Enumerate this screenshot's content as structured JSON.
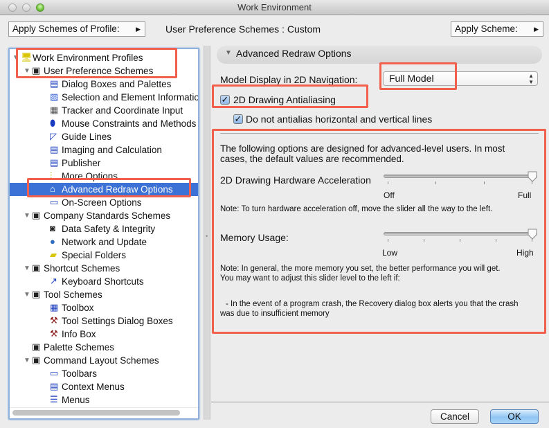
{
  "window": {
    "title": "Work Environment"
  },
  "toolbar": {
    "apply_profile_label": "Apply Schemes of Profile:",
    "current_scheme_label": "User Preference Schemes : Custom",
    "apply_scheme_label": "Apply Scheme:"
  },
  "tree": {
    "items": [
      {
        "label": "Work Environment Profiles",
        "level": 0,
        "expanded": true,
        "icon": "profiles-icon"
      },
      {
        "label": "User Preference Schemes",
        "level": 1,
        "expanded": true,
        "icon": "user-prefs-icon"
      },
      {
        "label": "Dialog Boxes and Palettes",
        "level": 2,
        "icon": "dialog-boxes-icon"
      },
      {
        "label": "Selection and Element Information",
        "level": 2,
        "icon": "selection-icon"
      },
      {
        "label": "Tracker and Coordinate Input",
        "level": 2,
        "icon": "tracker-icon"
      },
      {
        "label": "Mouse Constraints and Methods",
        "level": 2,
        "icon": "mouse-icon"
      },
      {
        "label": "Guide Lines",
        "level": 2,
        "icon": "guide-lines-icon"
      },
      {
        "label": "Imaging and Calculation",
        "level": 2,
        "icon": "imaging-icon"
      },
      {
        "label": "Publisher",
        "level": 2,
        "icon": "publisher-icon"
      },
      {
        "label": "More Options",
        "level": 2,
        "icon": "more-options-icon"
      },
      {
        "label": "Advanced Redraw Options",
        "level": 2,
        "icon": "redraw-icon",
        "selected": true
      },
      {
        "label": "On-Screen Options",
        "level": 2,
        "icon": "onscreen-icon"
      },
      {
        "label": "Company Standards Schemes",
        "level": 1,
        "expanded": true,
        "icon": "company-standards-icon"
      },
      {
        "label": "Data Safety & Integrity",
        "level": 2,
        "icon": "data-safety-icon"
      },
      {
        "label": "Network and Update",
        "level": 2,
        "icon": "network-globe-icon"
      },
      {
        "label": "Special Folders",
        "level": 2,
        "icon": "special-folders-icon"
      },
      {
        "label": "Shortcut Schemes",
        "level": 1,
        "expanded": true,
        "icon": "shortcut-schemes-icon"
      },
      {
        "label": "Keyboard Shortcuts",
        "level": 2,
        "icon": "keyboard-shortcuts-icon"
      },
      {
        "label": "Tool Schemes",
        "level": 1,
        "expanded": true,
        "icon": "tool-schemes-icon"
      },
      {
        "label": "Toolbox",
        "level": 2,
        "icon": "toolbox-icon"
      },
      {
        "label": "Tool Settings Dialog Boxes",
        "level": 2,
        "icon": "tool-settings-icon"
      },
      {
        "label": "Info Box",
        "level": 2,
        "icon": "info-box-icon"
      },
      {
        "label": "Palette Schemes",
        "level": 1,
        "expanded": false,
        "icon": "palette-schemes-icon"
      },
      {
        "label": "Command Layout Schemes",
        "level": 1,
        "expanded": true,
        "icon": "command-layout-icon"
      },
      {
        "label": "Toolbars",
        "level": 2,
        "icon": "toolbars-icon"
      },
      {
        "label": "Context Menus",
        "level": 2,
        "icon": "context-menus-icon"
      },
      {
        "label": "Menus",
        "level": 2,
        "icon": "menus-icon"
      }
    ]
  },
  "panel": {
    "section_title": "Advanced Redraw Options",
    "model_display_label": "Model Display in 2D Navigation:",
    "model_display_value": "Full Model",
    "antialiasing_label": "2D Drawing Antialiasing",
    "antialiasing_checked": true,
    "no_antialias_label": "Do not antialias horizontal and vertical lines",
    "no_antialias_checked": true,
    "intro_text_line1": "The following options are designed for advanced-level users. In most",
    "intro_text_line2": "cases, the default values are recommended.",
    "hw_accel": {
      "label": "2D Drawing Hardware Acceleration",
      "min_label": "Off",
      "max_label": "Full",
      "value_fraction": 1.0,
      "ticks": 4,
      "note": "Note: To turn hardware acceleration off, move the slider all the way to the left."
    },
    "memory": {
      "label": "Memory Usage:",
      "min_label": "Low",
      "max_label": "High",
      "value_fraction": 1.0,
      "ticks": 5,
      "note_line1": "Note: In general, the more memory you set, the better performance you will get.",
      "note_line2": "You may want to adjust this slider level to the left if:",
      "bullet_line1": "- In the event of a program crash, the Recovery dialog box alerts you that the crash",
      "bullet_line2": "was due to insufficient memory"
    }
  },
  "buttons": {
    "cancel": "Cancel",
    "ok": "OK"
  },
  "colors": {
    "highlight": "#f0604c",
    "selection": "#3c72d6",
    "ok_button": "#8fc4f2"
  }
}
